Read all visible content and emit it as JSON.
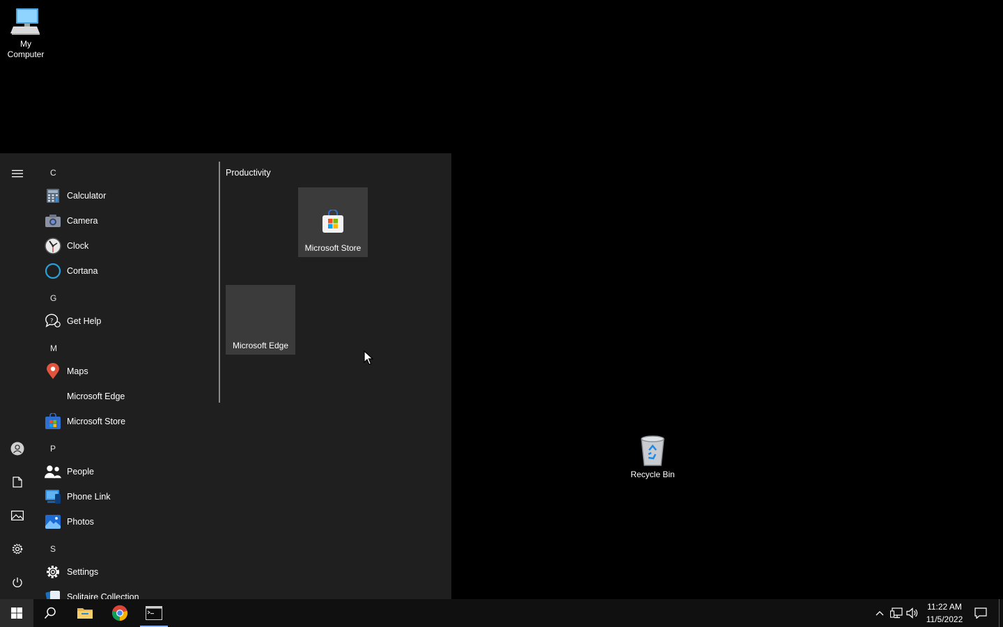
{
  "desktop": {
    "my_computer": "My\nComputer",
    "my_computer_line1": "My",
    "my_computer_line2": "Computer",
    "recycle_bin": "Recycle Bin"
  },
  "start_menu": {
    "letters": {
      "c": "C",
      "g": "G",
      "m": "M",
      "p": "P",
      "s": "S"
    },
    "apps": {
      "calculator": "Calculator",
      "camera": "Camera",
      "clock": "Clock",
      "cortana": "Cortana",
      "get_help": "Get Help",
      "maps": "Maps",
      "microsoft_edge": "Microsoft Edge",
      "microsoft_store": "Microsoft Store",
      "people": "People",
      "phone_link": "Phone Link",
      "photos": "Photos",
      "settings": "Settings",
      "solitaire": "Solitaire Collection"
    },
    "tiles": {
      "group_title": "Productivity",
      "store": "Microsoft Store",
      "edge": "Microsoft Edge"
    }
  },
  "taskbar": {
    "time": "11:22 AM",
    "date": "11/5/2022"
  },
  "colors": {
    "start_bg": "#1f1f1f",
    "tile_bg": "#3b3b3b",
    "taskbar_bg": "#101010",
    "active_indicator": "#8ab4f8"
  }
}
